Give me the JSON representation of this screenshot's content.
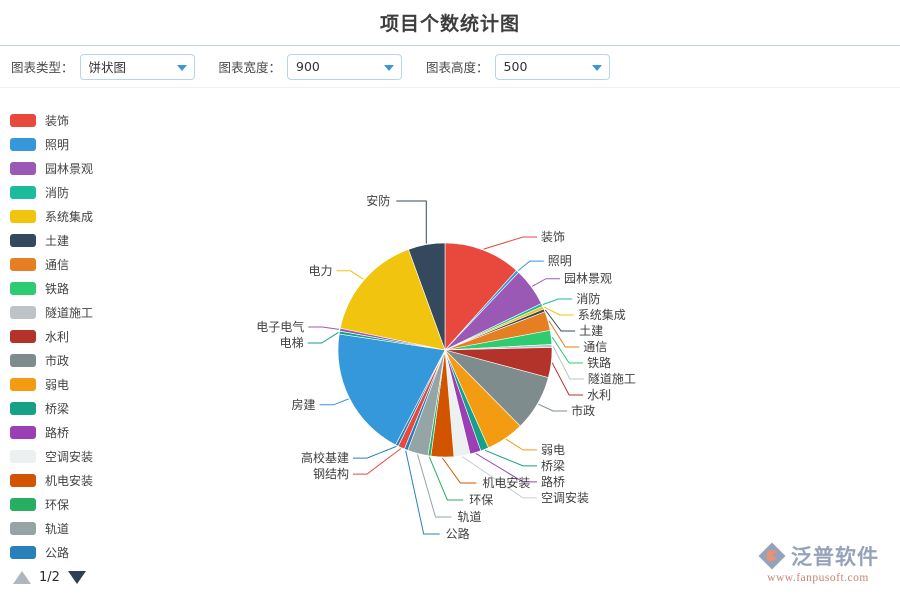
{
  "header": {
    "title": "项目个数统计图"
  },
  "toolbar": {
    "chart_type": {
      "label": "图表类型：",
      "value": "饼状图"
    },
    "chart_width": {
      "label": "图表宽度：",
      "value": "900"
    },
    "chart_height": {
      "label": "图表高度：",
      "value": "500"
    }
  },
  "legend": {
    "items": [
      {
        "label": "装饰",
        "color": "#e8493c"
      },
      {
        "label": "照明",
        "color": "#3498db"
      },
      {
        "label": "园林景观",
        "color": "#9b59b6"
      },
      {
        "label": "消防",
        "color": "#1abc9c"
      },
      {
        "label": "系统集成",
        "color": "#f1c40f"
      },
      {
        "label": "土建",
        "color": "#34495e"
      },
      {
        "label": "通信",
        "color": "#e67e22"
      },
      {
        "label": "铁路",
        "color": "#2ecc71"
      },
      {
        "label": "隧道施工",
        "color": "#bdc3c7"
      },
      {
        "label": "水利",
        "color": "#b3332a"
      },
      {
        "label": "市政",
        "color": "#7f8c8d"
      },
      {
        "label": "弱电",
        "color": "#f39c12"
      },
      {
        "label": "桥梁",
        "color": "#16a085"
      },
      {
        "label": "路桥",
        "color": "#9b3fb5"
      },
      {
        "label": "空调安装",
        "color": "#ecf0f1"
      },
      {
        "label": "机电安装",
        "color": "#d35400"
      },
      {
        "label": "环保",
        "color": "#27ae60"
      },
      {
        "label": "轨道",
        "color": "#95a5a6"
      },
      {
        "label": "公路",
        "color": "#2980b9"
      }
    ]
  },
  "pager": {
    "text": "1/2",
    "prev_icon": "triangle-up-icon",
    "next_icon": "triangle-down-icon"
  },
  "logo": {
    "name": "泛普软件",
    "url": "www.fanpusoft.com"
  },
  "chart_data": {
    "type": "pie",
    "title": "项目个数统计图",
    "legend_position": "left",
    "start_angle_deg": 0,
    "direction": "clockwise",
    "labels": [
      "装饰",
      "照明",
      "园林景观",
      "消防",
      "系统集成",
      "土建",
      "通信",
      "铁路",
      "隧道施工",
      "水利",
      "市政",
      "弱电",
      "桥梁",
      "路桥",
      "空调安装",
      "机电安装",
      "环保",
      "轨道",
      "公路",
      "钢结构",
      "高校基建",
      "房建",
      "电梯",
      "电子电气",
      "电力",
      "安防"
    ],
    "values": [
      10.5,
      0.4,
      5.2,
      0.4,
      0.4,
      0.4,
      2.6,
      1.9,
      0.4,
      4.1,
      7.6,
      5.2,
      1.1,
      1.5,
      2.2,
      3.1,
      0.4,
      2.8,
      0.5,
      0.9,
      0.4,
      17.8,
      0.4,
      0.4,
      14.6,
      5.0
    ],
    "colors": [
      "#e8493c",
      "#3498db",
      "#9b59b6",
      "#1abc9c",
      "#f1c40f",
      "#34495e",
      "#e67e22",
      "#2ecc71",
      "#bdc3c7",
      "#b3332a",
      "#7f8c8d",
      "#f39c12",
      "#16a085",
      "#9b3fb5",
      "#ecf0f1",
      "#d35400",
      "#27ae60",
      "#95a5a6",
      "#2980b9",
      "#e8493c",
      "#2980b9",
      "#3498db",
      "#16a085",
      "#9b59b6",
      "#f1c40f",
      "#34495e"
    ],
    "label_sides": [
      "r",
      "r",
      "r",
      "r",
      "r",
      "r",
      "r",
      "r",
      "r",
      "r",
      "r",
      "r",
      "r",
      "r",
      "r",
      "b",
      "b",
      "b",
      "b",
      "l",
      "l",
      "l",
      "l",
      "l",
      "l",
      "t"
    ]
  }
}
